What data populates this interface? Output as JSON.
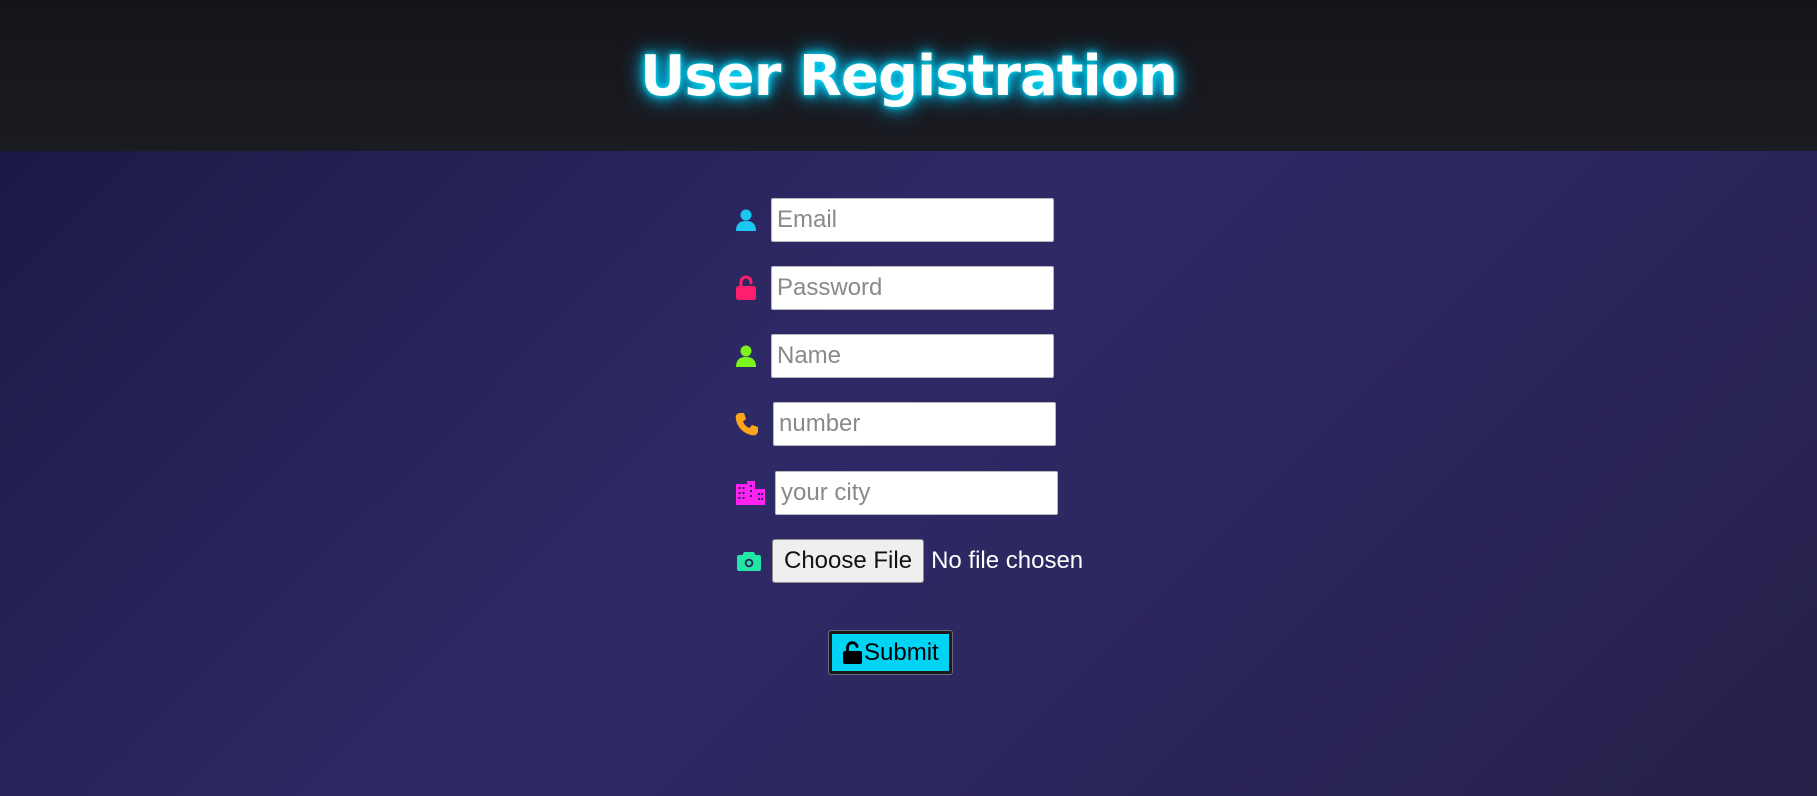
{
  "header": {
    "title": "User Registration"
  },
  "form": {
    "email": {
      "placeholder": "Email",
      "icon": "user-icon",
      "icon_color": "#1cc8f2"
    },
    "password": {
      "placeholder": "Password",
      "icon": "unlock-icon",
      "icon_color": "#ff1e6e"
    },
    "name": {
      "placeholder": "Name",
      "icon": "user-icon",
      "icon_color": "#7cf51c"
    },
    "number": {
      "placeholder": "number",
      "icon": "phone-icon",
      "icon_color": "#ffa51c"
    },
    "city": {
      "placeholder": "your city",
      "icon": "city-icon",
      "icon_color": "#ff22f0"
    },
    "photo": {
      "button_label": "Choose File",
      "status": "No file chosen",
      "icon": "camera-icon",
      "icon_color": "#22e6a4"
    },
    "submit": {
      "label": "Submit",
      "icon": "unlock-icon",
      "color": "#00d4f5"
    }
  }
}
